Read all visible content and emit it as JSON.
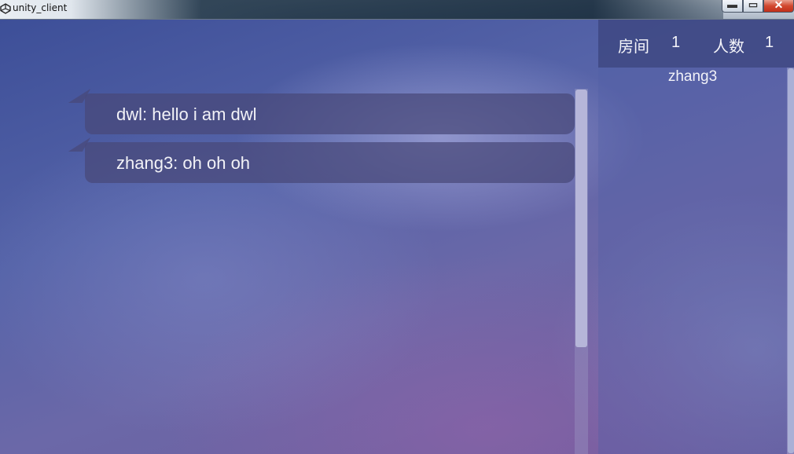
{
  "window": {
    "title": "unity_client",
    "icon": "unity-icon"
  },
  "controls": {
    "minimize_glyph": "▬",
    "maximize_glyph": "▭",
    "close_glyph": "✕"
  },
  "messages": [
    {
      "text": "dwl: hello i am dwl"
    },
    {
      "text": "zhang3: oh oh oh"
    }
  ],
  "room": {
    "room_label": "房间",
    "room_number": "1",
    "count_label": "人数",
    "count_number": "1"
  },
  "users": [
    {
      "name": "zhang3"
    }
  ],
  "colors": {
    "bubble": "#484878",
    "header": "#3e4882",
    "close_button": "#d2482f"
  }
}
